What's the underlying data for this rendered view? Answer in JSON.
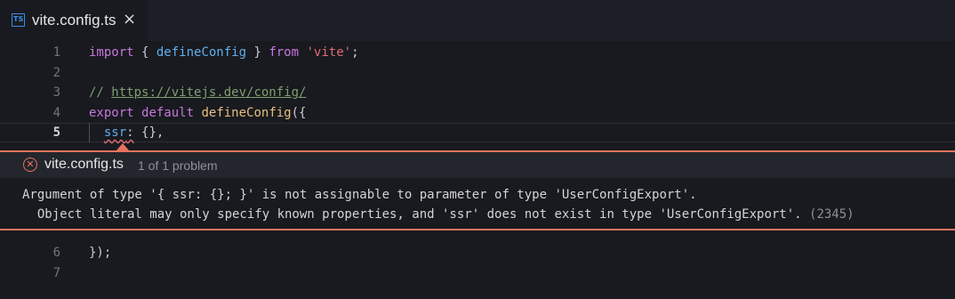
{
  "tab": {
    "icon": "typescript-file-icon",
    "icon_text": "TS",
    "label": "vite.config.ts",
    "close_glyph": "×"
  },
  "editor": {
    "lines_before": [
      {
        "num": "1",
        "parts": [
          [
            "kw",
            "import"
          ],
          [
            "punc",
            " { "
          ],
          [
            "fn",
            "defineConfig"
          ],
          [
            "punc",
            " } "
          ],
          [
            "kw",
            "from"
          ],
          [
            "punc",
            " "
          ],
          [
            "str",
            "'vite'"
          ],
          [
            "punc",
            ";"
          ]
        ]
      },
      {
        "num": "2",
        "parts": []
      },
      {
        "num": "3",
        "parts": [
          [
            "cm",
            "// "
          ],
          [
            "cm-url",
            "https://vitejs.dev/config/"
          ]
        ]
      },
      {
        "num": "4",
        "parts": [
          [
            "kw",
            "export"
          ],
          [
            "punc",
            " "
          ],
          [
            "kw",
            "default"
          ],
          [
            "punc",
            " "
          ],
          [
            "fn2",
            "defineConfig"
          ],
          [
            "punc",
            "({"
          ]
        ]
      },
      {
        "num": "5",
        "parts": [
          [
            "punc",
            "  "
          ],
          [
            "prop squiggle",
            "ssr"
          ],
          [
            "punc squiggle",
            ":"
          ],
          [
            "punc",
            " {},"
          ]
        ],
        "active": true
      }
    ],
    "lines_after": [
      {
        "num": "6",
        "parts": [
          [
            "punc",
            "});"
          ]
        ]
      },
      {
        "num": "7",
        "parts": []
      }
    ]
  },
  "problem_peek": {
    "icon": "error-circle-icon",
    "file": "vite.config.ts",
    "count": "1 of 1 problem",
    "message_line1": "Argument of type '{ ssr: {}; }' is not assignable to parameter of type 'UserConfigExport'.",
    "message_line2": "  Object literal may only specify known properties, and 'ssr' does not exist in type 'UserConfigExport'.",
    "error_code": " (2345)"
  },
  "colors": {
    "background": "#181a1f",
    "error_accent": "#e8735d",
    "keyword": "#c678dd",
    "string": "#e06c75",
    "comment": "#7f9f6f"
  }
}
